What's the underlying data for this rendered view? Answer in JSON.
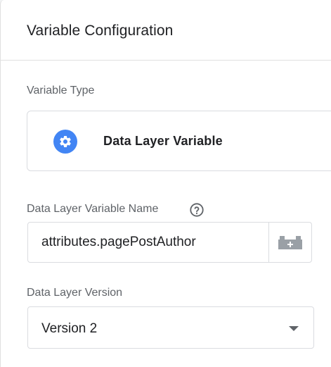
{
  "panel": {
    "title": "Variable Configuration"
  },
  "variable_type": {
    "label": "Variable Type",
    "selected_name": "Data Layer Variable",
    "icon": "gear-icon",
    "icon_color": "#4285f4"
  },
  "dlv_name": {
    "label": "Data Layer Variable Name",
    "help_icon": "help-circle-icon",
    "value": "attributes.pagePostAuthor",
    "picker_icon": "add-variable-icon"
  },
  "dl_version": {
    "label": "Data Layer Version",
    "selected": "Version 2",
    "dropdown_icon": "caret-down-icon"
  }
}
